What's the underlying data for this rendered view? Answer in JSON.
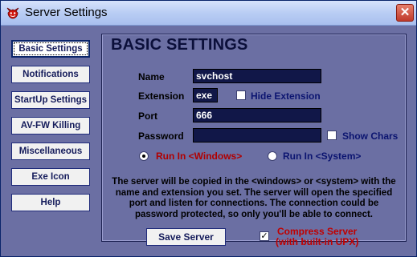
{
  "window": {
    "title": "Server Settings",
    "close_glyph": "✕"
  },
  "nav": {
    "items": [
      {
        "label": "Basic Settings",
        "active": true
      },
      {
        "label": "Notifications"
      },
      {
        "label": "StartUp Settings"
      },
      {
        "label": "AV-FW Killing"
      },
      {
        "label": "Miscellaneous"
      },
      {
        "label": "Exe Icon"
      },
      {
        "label": "Help"
      }
    ]
  },
  "panel": {
    "title": "BASIC SETTINGS",
    "name_label": "Name",
    "name_value": "svchost",
    "extension_label": "Extension",
    "extension_value": "exe",
    "hide_extension_label": "Hide Extension",
    "port_label": "Port",
    "port_value": "666",
    "password_label": "Password",
    "password_value": "",
    "show_chars_label": "Show Chars",
    "run_windows_label": "Run In <Windows>",
    "run_system_label": "Run In <System>",
    "run_selected": "windows",
    "description": "The server will be copied in the <windows> or <system> with the name and extension you set. The server will open the specified port and listen for connections. The connection could be password protected, so only you'll be able to connect."
  },
  "footer": {
    "save_label": "Save Server",
    "compress_checked": true,
    "compress_line1": "Compress Server",
    "compress_line2": "(with built-in UPX)"
  },
  "colors": {
    "background": "#6b6fa3",
    "field_bg": "#111748",
    "run_windows_color": "#b00000",
    "run_system_color": "#0b1470",
    "compress_color": "#c00000"
  },
  "icons": {
    "app": "devil-face-icon",
    "close": "close-icon"
  }
}
